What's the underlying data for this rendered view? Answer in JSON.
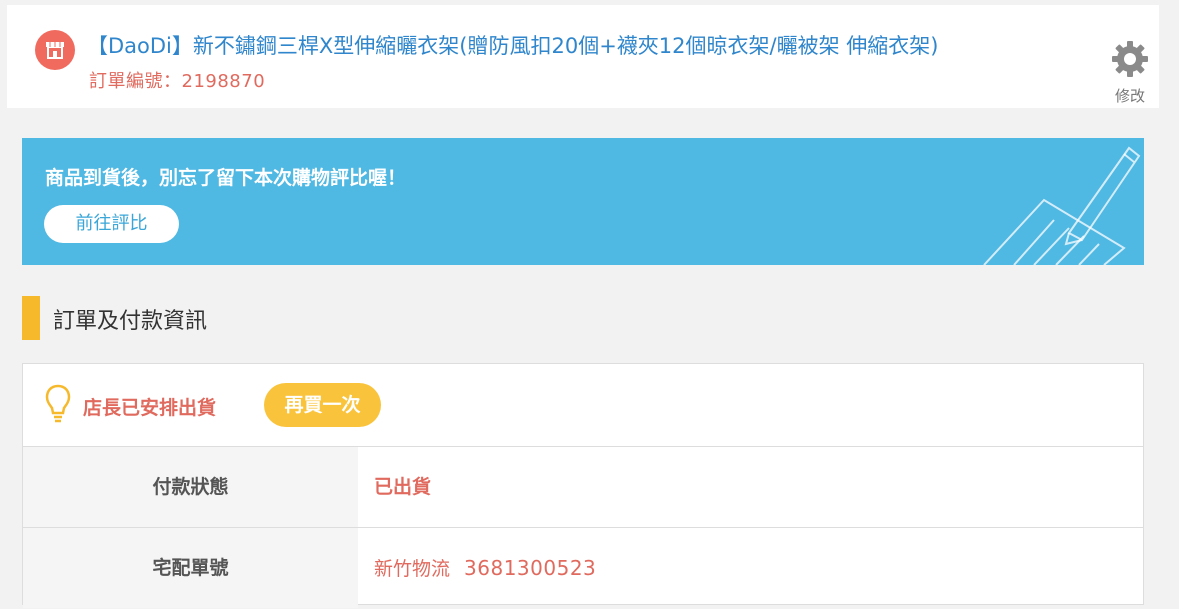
{
  "header": {
    "shop_icon": "store-icon",
    "product_title": "【DaoDi】新不鏽鋼三桿X型伸縮曬衣架(贈防風扣20個+襪夾12個晾衣架/曬被架 伸縮衣架)",
    "order_number": "訂單編號：2198870",
    "edit_icon": "gear-icon",
    "edit_label": "修改"
  },
  "banner": {
    "text": "商品到貨後，別忘了留下本次購物評比喔！",
    "button_label": "前往評比",
    "decoration_icon": "pen-paper-icon",
    "background": "#4fb8e3"
  },
  "section": {
    "title": "訂單及付款資訊",
    "accent": "#f6b92b"
  },
  "status": {
    "icon": "lightbulb-icon",
    "text": "店長已安排出貨",
    "buy_again_label": "再買一次",
    "buy_again_color": "#f9c43c"
  },
  "rows": [
    {
      "label": "付款狀態",
      "value": "已出貨"
    },
    {
      "label": "宅配單號",
      "carrier": "新竹物流",
      "tracking": "3681300523"
    }
  ]
}
